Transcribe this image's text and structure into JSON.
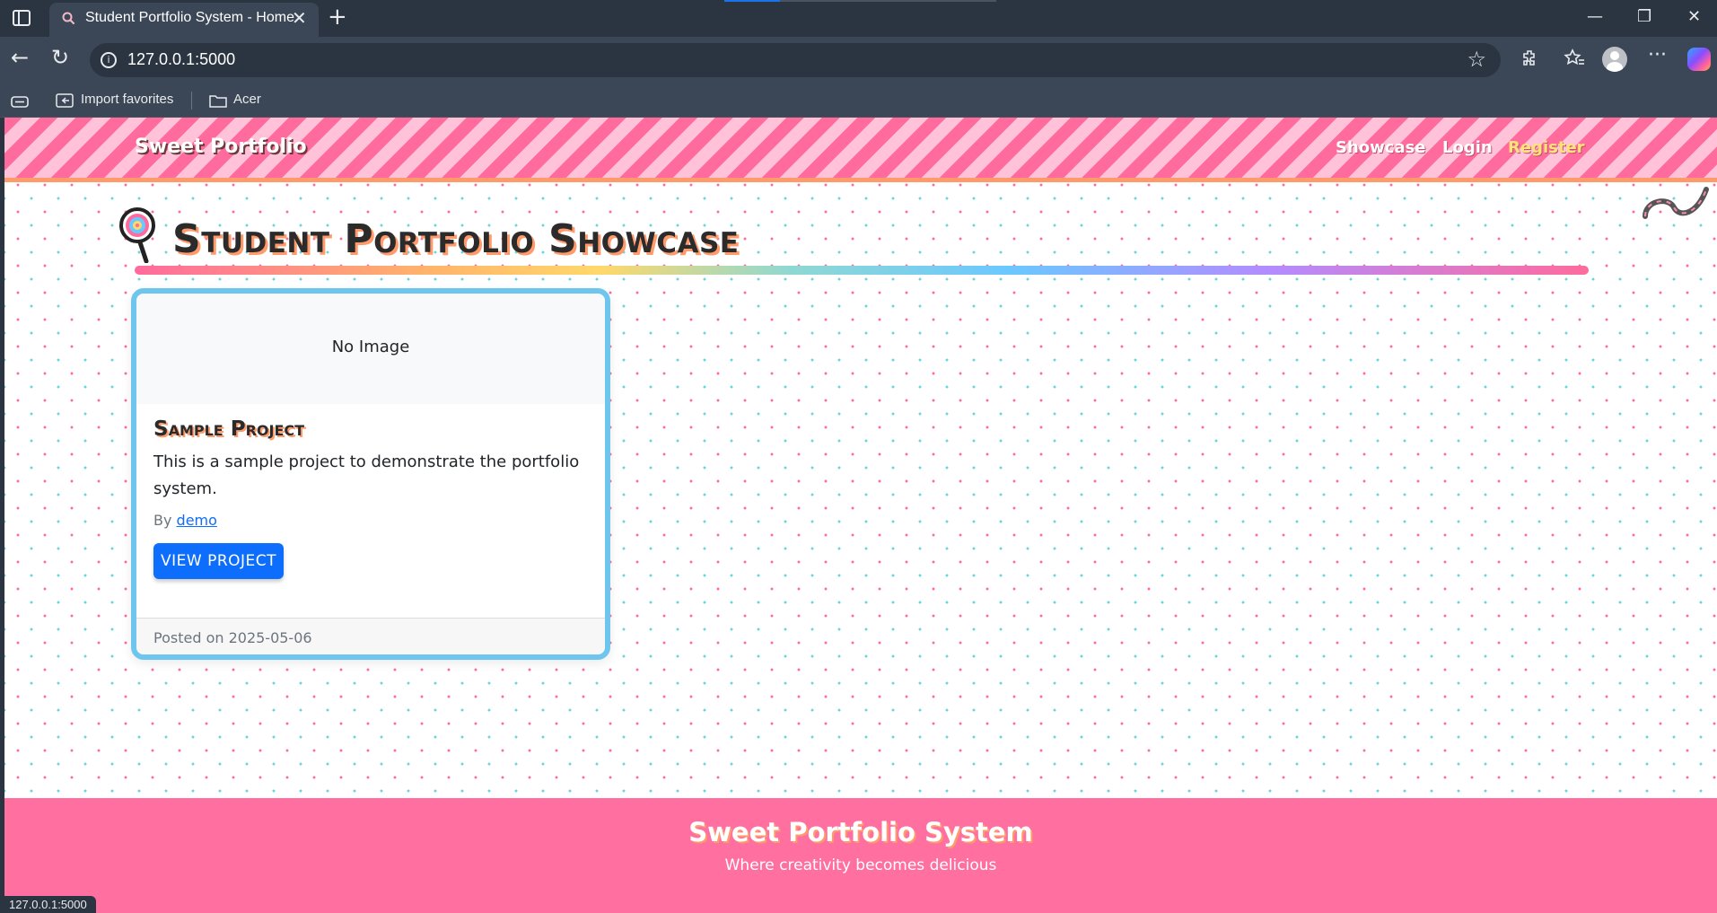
{
  "browser": {
    "tab_title": "Student Portfolio System - Home",
    "url": "127.0.0.1:5000",
    "bookmarks": [
      "Import favorites",
      "Acer"
    ],
    "status_url": "127.0.0.1:5000",
    "icons": [
      "sidebar-toggle-icon",
      "search-favicon",
      "close-icon",
      "plus-icon",
      "minimize-icon",
      "restore-icon",
      "close-window-icon",
      "back-icon",
      "refresh-icon",
      "info-icon",
      "star-icon",
      "extensions-icon",
      "favorites-icon",
      "profile-icon",
      "more-icon",
      "copilot-icon"
    ]
  },
  "site": {
    "brand": "Sweet Portfolio",
    "nav": [
      "Showcase",
      "Login",
      "Register"
    ],
    "page_title": "Student Portfolio Showcase",
    "colors": {
      "nav_stripe_pink": "#ff6b9d",
      "nav_stripe_light": "#ffc2d8",
      "card_border": "#6ec6ee",
      "button_blue": "#0d6efd",
      "footer_pink": "#ff6fa0",
      "register_yellow": "#ffe27a"
    }
  },
  "projects": [
    {
      "image_placeholder": "No Image",
      "title": "Sample Project",
      "description": "This is a sample project to demonstrate the portfolio system.",
      "by_label": "By",
      "author": "demo",
      "button": "VIEW PROJECT",
      "posted": "Posted on 2025-05-06"
    }
  ],
  "footer": {
    "title": "Sweet Portfolio System",
    "tagline": "Where creativity becomes delicious"
  }
}
